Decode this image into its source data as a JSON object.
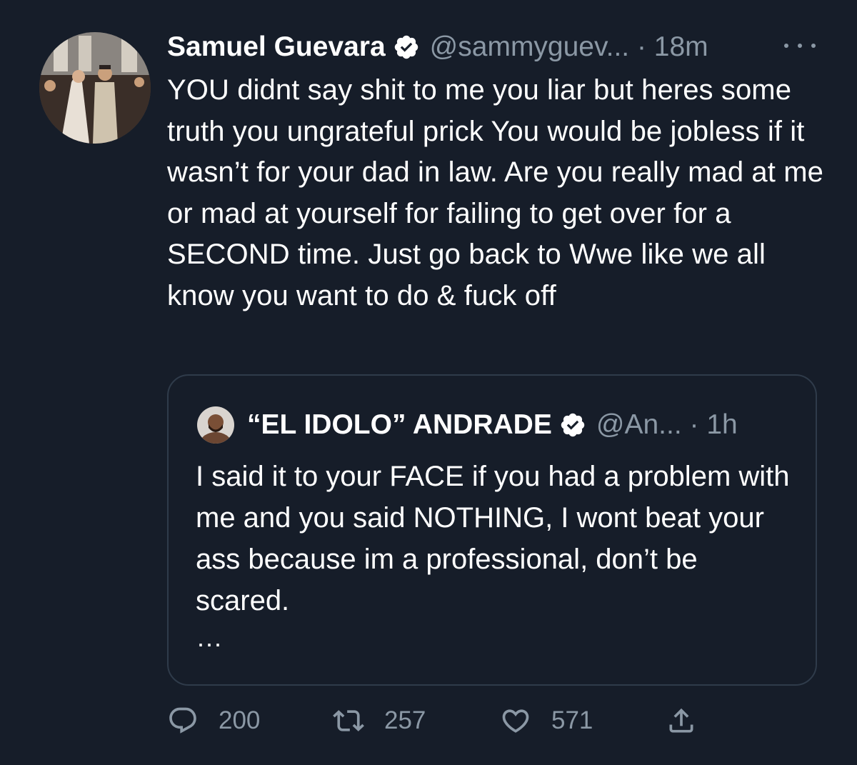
{
  "tweet": {
    "author_name": "Samuel Guevara",
    "handle_time": "@sammyguev... · 18m",
    "verified": true,
    "text": "YOU didnt say shit to me you liar but heres some truth you ungrateful prick You would be jobless if it wasn’t for your dad in law. Are you really mad at me or mad at yourself for failing to get over for a SECOND time. Just go back to Wwe like we all know you want to do & fuck off"
  },
  "quoted_tweet": {
    "author_name": "“EL IDOLO” ANDRADE",
    "handle_time": "@An... · 1h",
    "verified": true,
    "text": "I said it to your FACE if you had a problem with me and you said NOTHING, I wont beat your ass because im a professional, don’t be scared.",
    "truncation": "..."
  },
  "actions": {
    "replies": "200",
    "retweets": "257",
    "likes": "571"
  },
  "colors": {
    "background": "#161d29",
    "text": "#ffffff",
    "secondary": "#8b98a5",
    "border": "#2f3b4a"
  },
  "icons": [
    "reply-icon",
    "retweet-icon",
    "like-icon",
    "share-icon",
    "verified-badge-icon",
    "more-icon"
  ]
}
